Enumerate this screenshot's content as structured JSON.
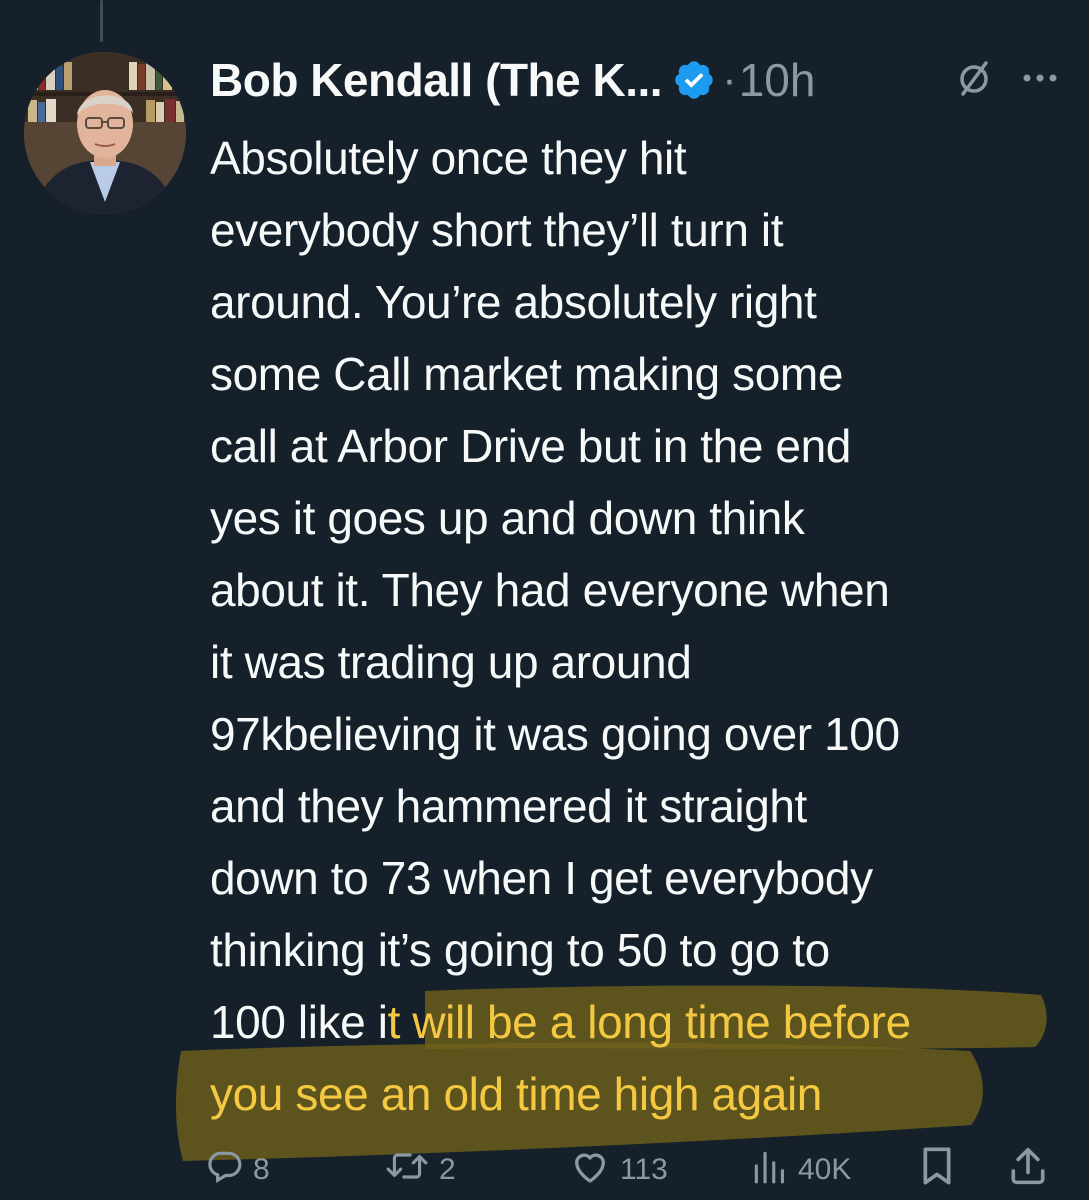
{
  "tweet": {
    "author_name": "Bob Kendall (The K...",
    "separator": "·",
    "time_ago": "10h",
    "lines": [
      {
        "text": "Absolutely once they hit"
      },
      {
        "text": "everybody short they’ll turn it"
      },
      {
        "text": "around. You’re absolutely right"
      },
      {
        "text": "some Call market making some"
      },
      {
        "text": "call at Arbor Drive but in the end"
      },
      {
        "text": "yes it goes up and down think"
      },
      {
        "text": "about it. They had everyone when"
      },
      {
        "text": "it was trading up around"
      },
      {
        "text": "97kbelieving it was going over 100"
      },
      {
        "text": "and they hammered it straight"
      },
      {
        "text": "down to 73 when I get everybody"
      },
      {
        "text": "thinking it’s going to 50 to go to"
      },
      {
        "pre": "100 like i",
        "highlight": "t will be a long time before"
      },
      {
        "pre": "",
        "highlight": "you see an old time high again"
      }
    ]
  },
  "actions": {
    "replies": "8",
    "retweets": "2",
    "likes": "113",
    "views": "40K"
  },
  "colors": {
    "background": "#15202b",
    "text": "#f7f9f9",
    "secondary": "#8b98a5",
    "verified": "#1d9bf0",
    "highlight_text": "#f5c842",
    "highlight_marker": "#7a6a12"
  },
  "icons": {
    "verified": "verified-badge-icon",
    "grok": "slashed-circle-icon",
    "more": "more-dots-icon",
    "reply": "reply-bubble-icon",
    "retweet": "retweet-icon",
    "like": "heart-icon",
    "views": "bar-chart-icon",
    "bookmark": "bookmark-icon",
    "share": "share-icon"
  }
}
